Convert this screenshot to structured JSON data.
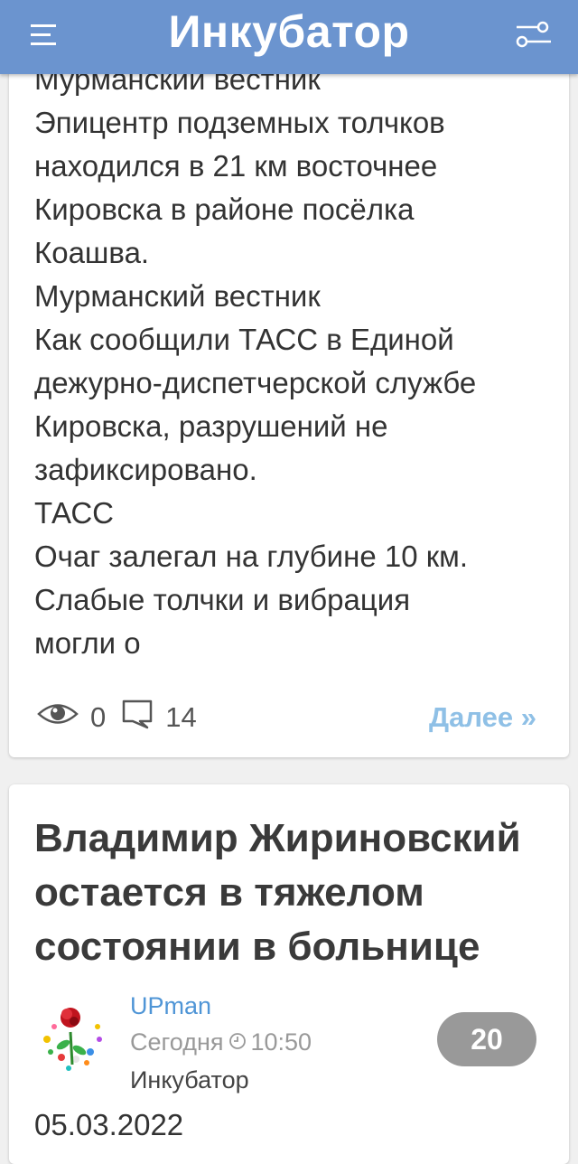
{
  "header": {
    "title": "Инкубатор",
    "menu_icon": "hamburger-menu-icon",
    "filter_icon": "filter-sliders-icon",
    "color": "#6b94cf"
  },
  "post1": {
    "excerpt_lines": [
      "Мурманский вестник",
      "Эпицентр подземных толчков",
      "находился в 21 км восточнее",
      "Кировска в районе посёлка",
      "Коашва.",
      "Мурманский вестник",
      "Как сообщили ТАСС в Единой",
      "дежурно-диспетчерской службе",
      "Кировска, разрушений не",
      "зафиксировано.",
      "ТАСС",
      "Очаг залегал на глубине 10 км.",
      "Слабые толчки и вибрация",
      "могли о"
    ],
    "views": "0",
    "comments": "14",
    "more_label": "Далее »"
  },
  "post2": {
    "title_lines": [
      "Владимир Жириновский",
      "остается в тяжелом",
      "состоянии в больнице"
    ],
    "author": "UPman",
    "date_label": "Сегодня",
    "time": "10:50",
    "category": "Инкубатор",
    "rating": "20",
    "post_date": "05.03.2022"
  }
}
